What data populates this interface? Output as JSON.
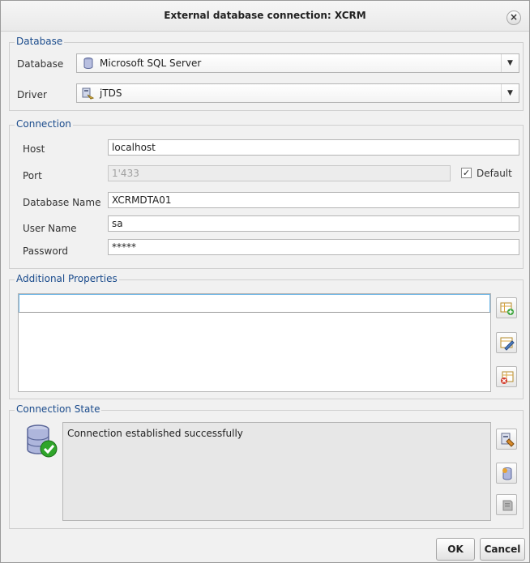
{
  "window": {
    "title": "External database connection: XCRM",
    "close_glyph": "×"
  },
  "database_group": {
    "legend": "Database",
    "database_label": "Database",
    "database_value": "Microsoft SQL Server",
    "driver_label": "Driver",
    "driver_value": "jTDS",
    "caret": "▼"
  },
  "connection_group": {
    "legend": "Connection",
    "host_label": "Host",
    "host_value": "localhost",
    "port_label": "Port",
    "port_value": "1'433",
    "default_label": "Default",
    "default_checked": "✓",
    "dbname_label": "Database Name",
    "dbname_value": "XCRMDTA01",
    "user_label": "User Name",
    "user_value": "sa",
    "password_label": "Password",
    "password_value": "*****"
  },
  "additional_properties": {
    "legend": "Additional Properties",
    "buttons": [
      "add-row-icon",
      "edit-row-icon",
      "delete-row-icon"
    ]
  },
  "connection_state": {
    "legend": "Connection State",
    "message": "Connection established successfully",
    "status_icon": "database-success-icon",
    "buttons": [
      "test-connection-icon",
      "database-info-icon",
      "disconnect-icon"
    ]
  },
  "footer": {
    "ok_label": "OK",
    "cancel_label": "Cancel"
  },
  "colors": {
    "legend": "#1a4b8c",
    "success": "#2fa52a",
    "focus_border": "#6fb6e6"
  }
}
